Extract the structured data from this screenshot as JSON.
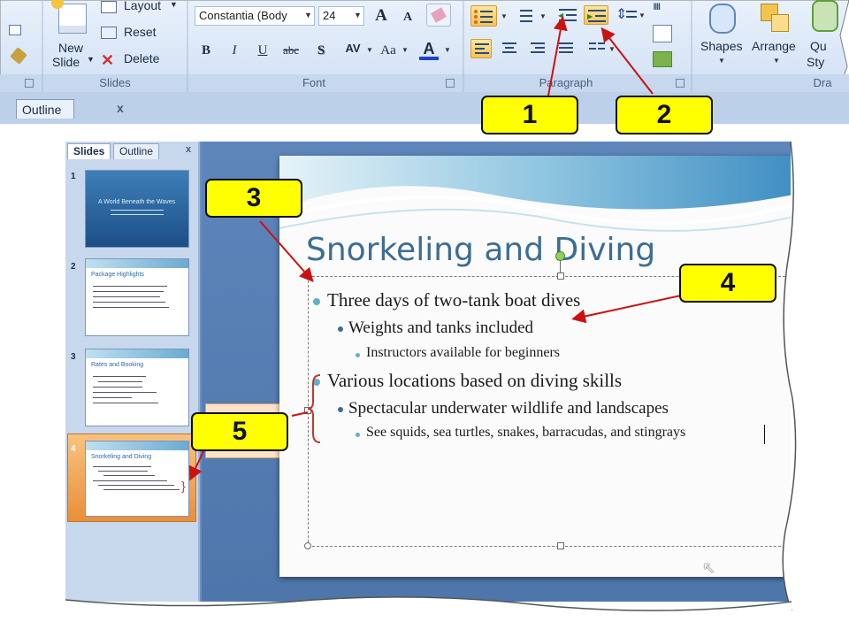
{
  "ribbon": {
    "slides_group": {
      "label": "Slides",
      "new_slide_line1": "New",
      "new_slide_line2": "Slide",
      "layout": "Layout",
      "reset": "Reset",
      "delete": "Delete"
    },
    "font_group": {
      "label": "Font",
      "font_name": "Constantia (Body",
      "font_size": "24",
      "grow": "A",
      "shrink": "A",
      "bold": "B",
      "italic": "I",
      "underline": "U",
      "strike": "abc",
      "shadow": "S",
      "spacing": "AV",
      "case": "Aa",
      "color": "A"
    },
    "paragraph_group": {
      "label": "Paragraph"
    },
    "drawing_group": {
      "label": "Dra",
      "shapes": "Shapes",
      "arrange": "Arrange",
      "quick_styles_line1": "Qu",
      "quick_styles_line2": "Sty"
    }
  },
  "outline_tab_strip": {
    "label": "Outline",
    "close": "x"
  },
  "callouts": [
    "1",
    "2",
    "3",
    "4",
    "5"
  ],
  "panel": {
    "tabs": [
      "Slides",
      "Outline"
    ],
    "close": "x",
    "slide_numbers": [
      "1",
      "2",
      "3",
      "4"
    ],
    "thumb_titles": [
      "A World Beneath the Waves",
      "Package Highlights",
      "Rates and Booking",
      "Snorkeling and Diving"
    ]
  },
  "slide": {
    "title": "Snorkeling and Diving",
    "bullets": [
      {
        "level": 1,
        "text": "Three days of two-tank boat dives"
      },
      {
        "level": 2,
        "text": "Weights and tanks included"
      },
      {
        "level": 3,
        "text": "Instructors available for beginners"
      },
      {
        "level": 1,
        "text": "Various locations based on diving skills"
      },
      {
        "level": 2,
        "text": "Spectacular underwater wildlife and landscapes"
      },
      {
        "level": 3,
        "text": "See squids, sea turtles, snakes, barracudas, and stingrays"
      }
    ]
  },
  "colors": {
    "callout_fill": "#ffff00",
    "arrow": "#cc1111",
    "title": "#3c6d95",
    "bullet_dot": "#5fb1c7"
  }
}
